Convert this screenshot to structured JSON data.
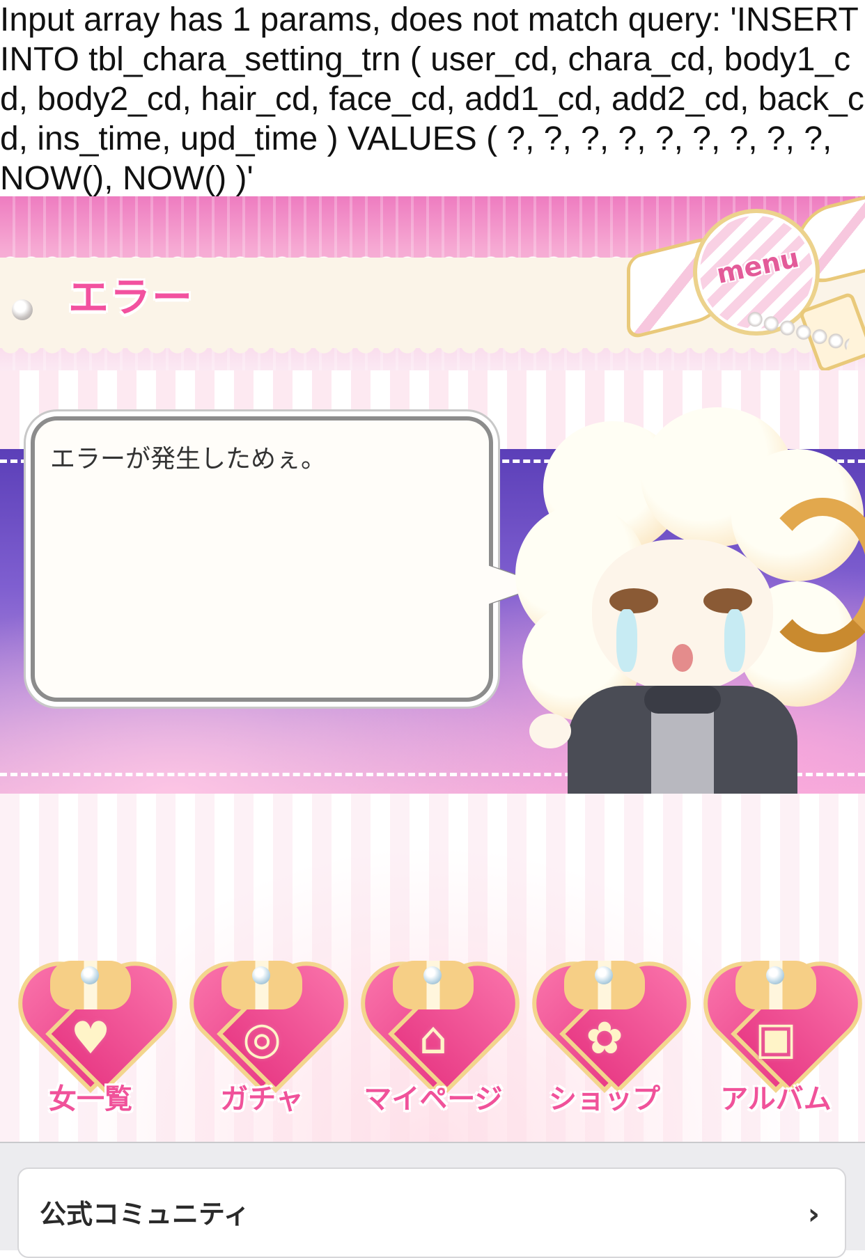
{
  "error_message": "Input array has 1 params, does not match query: 'INSERT INTO tbl_chara_setting_trn ( user_cd, chara_cd, body1_cd, body2_cd, hair_cd, face_cd, add1_cd, add2_cd, back_cd, ins_time, upd_time ) VALUES ( ?, ?, ?, ?, ?, ?, ?, ?, ?, NOW(), NOW() )'",
  "header": {
    "title": "エラー",
    "menu_label": "menu"
  },
  "dialog": {
    "message": "エラーが発生しためぇ。"
  },
  "nav": {
    "items": [
      {
        "label": "女一覧",
        "icon": "hearts-icon",
        "glyph": "♥"
      },
      {
        "label": "ガチャ",
        "icon": "rings-icon",
        "glyph": "◎"
      },
      {
        "label": "マイページ",
        "icon": "house-icon",
        "glyph": "⌂"
      },
      {
        "label": "ショップ",
        "icon": "candy-icon",
        "glyph": "✿"
      },
      {
        "label": "アルバム",
        "icon": "photo-icon",
        "glyph": "▣"
      }
    ]
  },
  "footer": {
    "community_label": "公式コミュニティ",
    "chevron": "›"
  },
  "colors": {
    "accent_pink": "#f0529a",
    "band_purple": "#5b3fb8",
    "gold_trim": "#f3d58d"
  }
}
